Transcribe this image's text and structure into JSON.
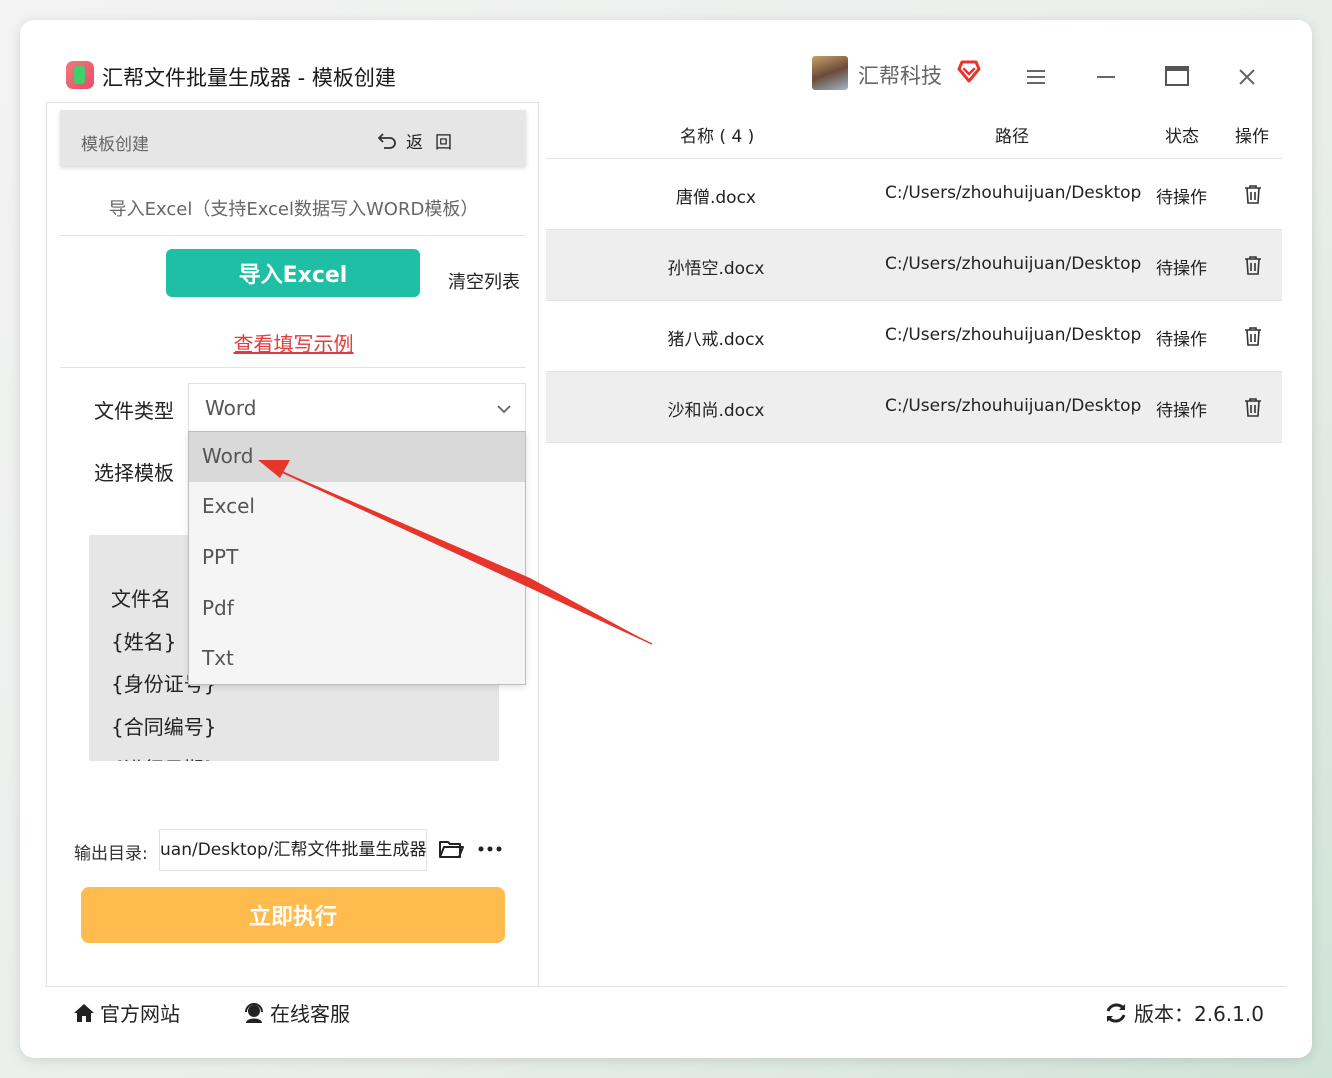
{
  "window": {
    "title": "汇帮文件批量生成器 - 模板创建",
    "brand": "汇帮科技"
  },
  "left": {
    "header_label": "模板创建",
    "back_label": "返回",
    "import_hint": "导入Excel（支持Excel数据写入WORD模板）",
    "import_button": "导入Excel",
    "clear_button": "清空列表",
    "example_link": "查看填写示例",
    "filetype_label": "文件类型",
    "filetype_value": "Word",
    "template_label": "选择模板",
    "filetype_options": [
      "Word",
      "Excel",
      "PPT",
      "Pdf",
      "Txt"
    ],
    "template_fields": [
      "文件名",
      "{姓名}",
      "{身份证号}",
      "{合同编号}",
      "{进行日期}"
    ],
    "output_label": "输出目录:",
    "output_value": "uan/Desktop/汇帮文件批量生成器",
    "run_button": "立即执行"
  },
  "table": {
    "headers": {
      "name": "名称 ( 4 )",
      "path": "路径",
      "status": "状态",
      "action": "操作"
    },
    "rows": [
      {
        "name": "唐僧.docx",
        "path": "C:/Users/zhouhuijuan/Desktop/",
        "status": "待操作"
      },
      {
        "name": "孙悟空.docx",
        "path": "C:/Users/zhouhuijuan/Desktop/",
        "status": "待操作"
      },
      {
        "name": "猪八戒.docx",
        "path": "C:/Users/zhouhuijuan/Desktop/",
        "status": "待操作"
      },
      {
        "name": "沙和尚.docx",
        "path": "C:/Users/zhouhuijuan/Desktop/",
        "status": "待操作"
      }
    ]
  },
  "footer": {
    "website": "官方网站",
    "support": "在线客服",
    "version": "版本：2.6.1.0"
  },
  "colors": {
    "import_button": "#1fbfa6",
    "run_button": "#ffbb4d",
    "link": "#e23b3b",
    "annotation_arrow": "#e8352c"
  },
  "icons": [
    "menu-icon",
    "minimize-icon",
    "maximize-icon",
    "close-icon",
    "vip-heart-icon",
    "back-arrow-icon",
    "chevron-down-icon",
    "folder-icon",
    "more-icon",
    "trash-icon",
    "home-icon",
    "headset-icon",
    "refresh-icon"
  ]
}
